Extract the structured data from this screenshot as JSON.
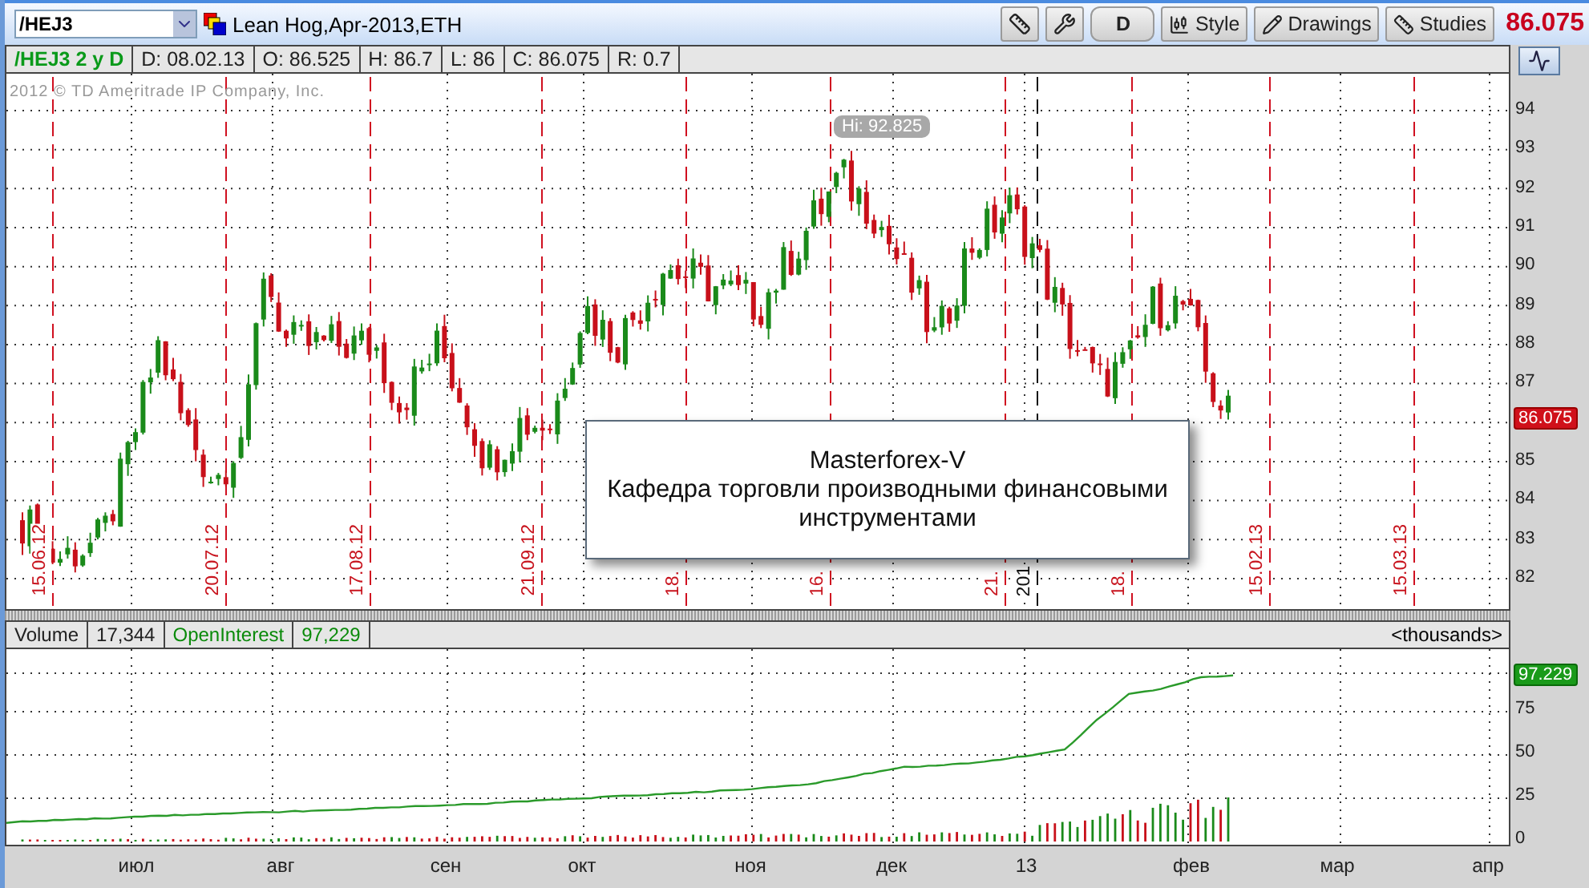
{
  "toolbar": {
    "symbol": "/HEJ3",
    "description": "Lean Hog,Apr-2013,ETH",
    "period_button": "D",
    "buttons": [
      "Style",
      "Drawings",
      "Studies"
    ],
    "last_price": "86.075"
  },
  "info_bar": {
    "title": "/HEJ3 2 y D",
    "fields": [
      "D: 08.02.13",
      "O: 86.525",
      "H: 86.7",
      "L: 86",
      "C: 86.075",
      "R: 0.7"
    ]
  },
  "price_chart": {
    "copyright": "2012 © TD Ameritrade IP Company, Inc.",
    "y_ticks": [
      "94",
      "93",
      "92",
      "91",
      "90",
      "89",
      "88",
      "87",
      "85",
      "84",
      "83",
      "82"
    ],
    "current_price": "86.075",
    "high_label": "Hi: 92.825",
    "date_markers": [
      {
        "label": "15.06.12",
        "kind": "date"
      },
      {
        "label": "20.07.12",
        "kind": "date"
      },
      {
        "label": "17.08.12",
        "kind": "date"
      },
      {
        "label": "21.09.12",
        "kind": "date"
      },
      {
        "label": "18.",
        "kind": "date"
      },
      {
        "label": "16.",
        "kind": "date"
      },
      {
        "label": "21.",
        "kind": "date"
      },
      {
        "label": "201",
        "kind": "year"
      },
      {
        "label": "18.",
        "kind": "date"
      },
      {
        "label": "15.02.13",
        "kind": "date"
      },
      {
        "label": "15.03.13",
        "kind": "date"
      }
    ],
    "note": {
      "title": "Masterforex-V",
      "text": "Кафедра торговли производными финансовыми инструментами"
    }
  },
  "lower_panel": {
    "legend": [
      {
        "label": "Volume",
        "value": "17,344",
        "kind": "volume"
      },
      {
        "label": "OpenInterest",
        "value": "97,229",
        "kind": "open_interest"
      }
    ],
    "units": "<thousands>",
    "current_value": "97.229",
    "y_ticks": [
      "75",
      "50",
      "25",
      "0"
    ]
  },
  "x_axis": [
    "июл",
    "авг",
    "сен",
    "окт",
    "ноя",
    "дек",
    "13",
    "фев",
    "мар",
    "апр"
  ]
}
